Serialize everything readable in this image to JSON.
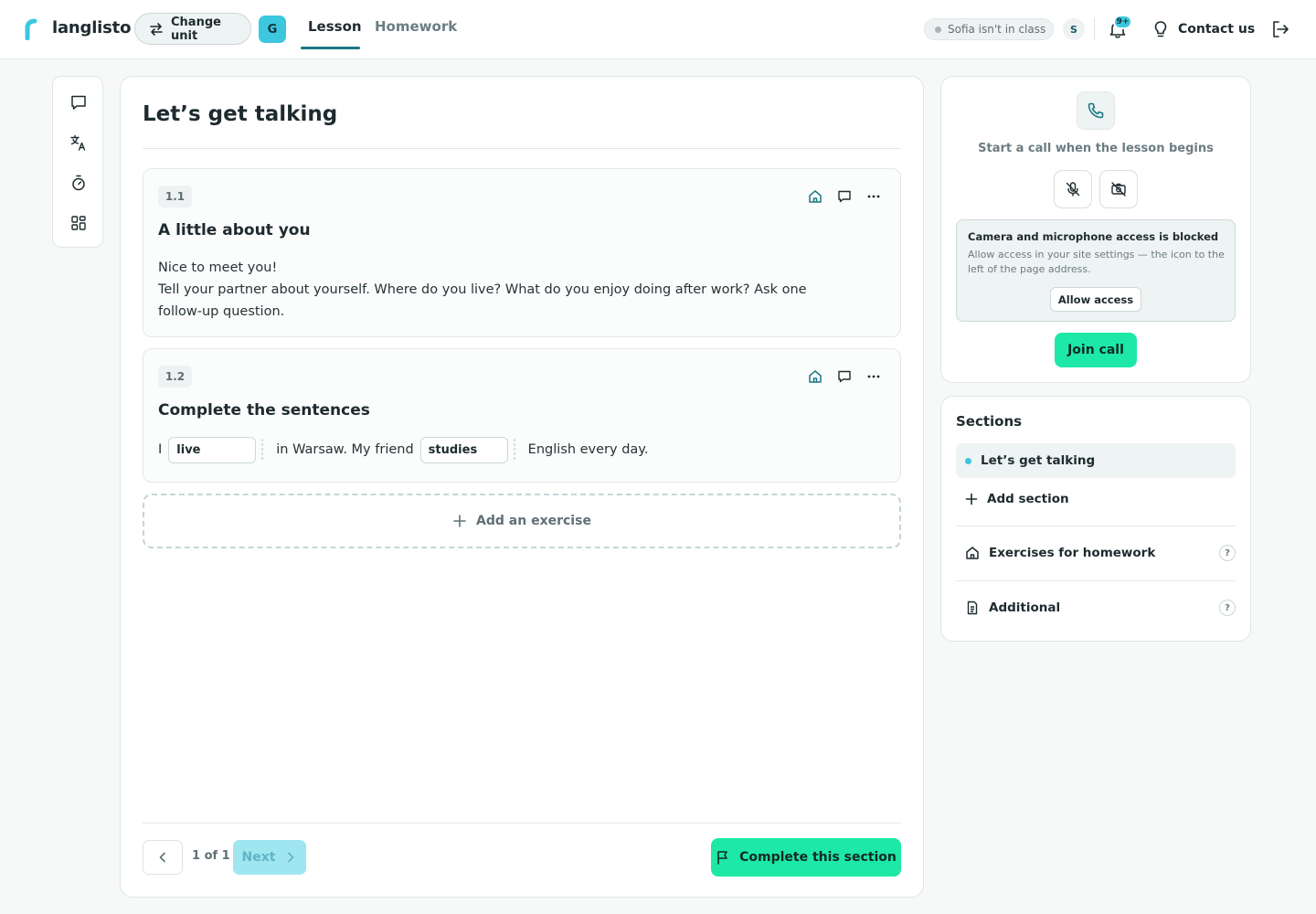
{
  "header": {
    "logo_text": "langlisto",
    "change_unit_label": "Change unit",
    "group_badge": "G",
    "tabs": [
      {
        "label": "Lesson",
        "active": true
      },
      {
        "label": "Homework",
        "active": false
      }
    ],
    "student_status": "Sofia isn't in class",
    "student_initial": "S",
    "notification_badge": "9+",
    "contact_label": "Contact us",
    "icons": {
      "change_unit": "swap-icon",
      "notifications": "bell-icon",
      "contact": "lightbulb-icon",
      "logout": "logout-icon"
    }
  },
  "toolbar": {
    "icons": [
      "chat-icon",
      "translate-icon",
      "timer-icon",
      "grid-icon"
    ]
  },
  "section": {
    "title": "Let’s get talking",
    "exercises": [
      {
        "number": "1.1",
        "title": "A little about you",
        "lines": [
          "Nice to meet you!",
          "Tell your partner about yourself. Where do you live? What do you enjoy doing after work? Ask one follow-up question."
        ]
      },
      {
        "number": "1.2",
        "title": "Complete the sentences",
        "parts": [
          "I",
          "in Warsaw. My friend",
          "English every day."
        ],
        "gaps": [
          "live",
          "studies"
        ]
      }
    ],
    "add_exercise_label": "Add an exercise",
    "pagination": "1 of 1",
    "next_label": "Next",
    "complete_label": "Complete this section"
  },
  "call": {
    "hint": "Start a call when the lesson begins",
    "blocked_title": "Camera and microphone access is blocked",
    "blocked_desc": "Allow access in your site settings — the icon to the left of the page address.",
    "allow_label": "Allow access",
    "join_label": "Join call"
  },
  "sections_panel": {
    "title": "Sections",
    "items": [
      {
        "label": "Let’s get talking",
        "active": true
      }
    ],
    "add_label": "Add section",
    "homework_label": "Exercises for homework",
    "additional_label": "Additional",
    "help_mark": "?"
  },
  "colors": {
    "accent": "#1de8a6",
    "brand": "#3cc7de",
    "tab_underline": "#1b7787",
    "text": "#1d2b2f"
  }
}
